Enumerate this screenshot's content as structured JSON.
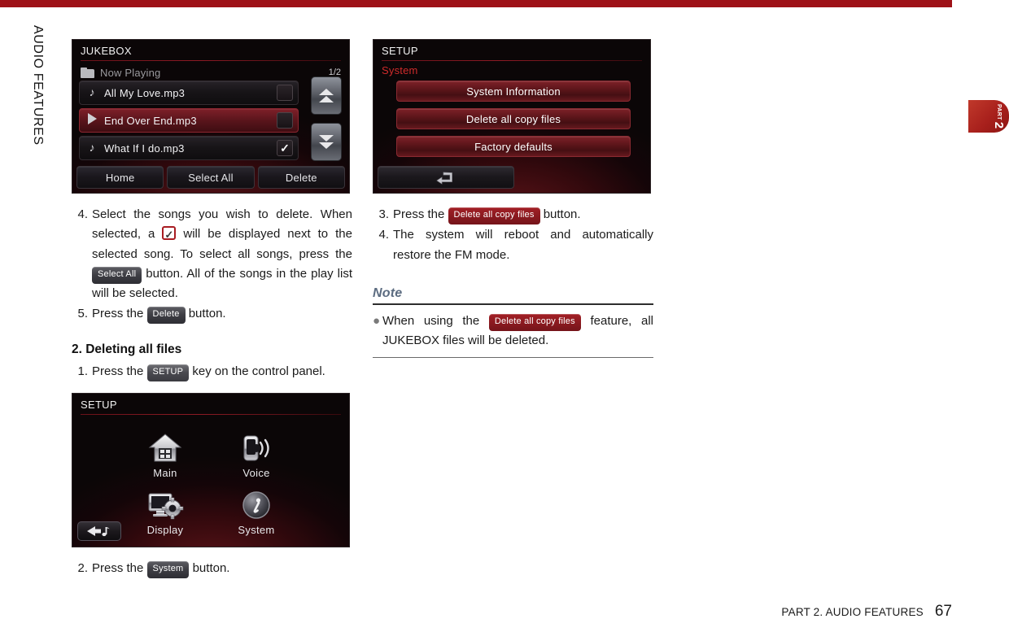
{
  "top_rule_color": "#9e1117",
  "side_tab": {
    "part_label": "PART",
    "part_number": "2",
    "section_label": "AUDIO FEATURES",
    "color": "#b02a22"
  },
  "jukebox_screen": {
    "title": "JUKEBOX",
    "subtitle": "Now Playing",
    "page_indicator": "1/2",
    "rows": [
      {
        "icon": "music-note-icon",
        "label": "All My Love.mp3",
        "checked": false,
        "active": false
      },
      {
        "icon": "play-icon",
        "label": "End Over End.mp3",
        "checked": false,
        "active": true
      },
      {
        "icon": "music-note-icon",
        "label": "What If I do.mp3",
        "checked": true,
        "active": false
      }
    ],
    "scroll_up": "scroll-up-icon",
    "scroll_down": "scroll-down-icon",
    "buttons": [
      "Home",
      "Select All",
      "Delete"
    ]
  },
  "setup_system_screen": {
    "title": "SETUP",
    "section": "System",
    "buttons": [
      "System Information",
      "Delete all copy files",
      "Factory defaults"
    ],
    "back_icon": "return-arrow-icon"
  },
  "setup_main_screen": {
    "title": "SETUP",
    "items": [
      {
        "label": "Main",
        "icon": "home-icon"
      },
      {
        "label": "Voice",
        "icon": "voice-phone-icon"
      },
      {
        "label": "Display",
        "icon": "display-gear-icon"
      },
      {
        "label": "System",
        "icon": "info-circle-icon"
      }
    ],
    "back_icon": "back-music-icon"
  },
  "left_column": {
    "step4": {
      "num": "4.",
      "part1": "Select the songs you wish to delete. When selected, a",
      "badge_checkmark": "checkmark-badge",
      "part2": "will be displayed next to the selected song. To select all songs, press the",
      "badge_select_all": "Select All",
      "part3": "button. All of the songs in the play list will be selected."
    },
    "step5": {
      "num": "5.",
      "part1": "Press the",
      "badge_delete": "Delete",
      "part2": "button."
    },
    "heading": "2. Deleting all files",
    "step1": {
      "num": "1.",
      "part1": "Press the",
      "badge_setup": "SETUP",
      "part2": "key on the control panel."
    },
    "step2": {
      "num": "2.",
      "part1": "Press the",
      "badge_system": "System",
      "part2": "button."
    }
  },
  "right_column": {
    "step3": {
      "num": "3.",
      "part1": "Press the",
      "badge_delete_all": "Delete all copy files",
      "part2": "button."
    },
    "step4": {
      "num": "4.",
      "text": "The system will reboot and automatically restore the FM mode."
    },
    "note": {
      "heading": "Note",
      "bullet": "●",
      "part1": "When using the",
      "badge_delete_all": "Delete all copy files",
      "part2": "feature, all JUKEBOX files will be deleted."
    }
  },
  "footer": {
    "text": "PART 2. AUDIO FEATURES",
    "page": "67"
  }
}
